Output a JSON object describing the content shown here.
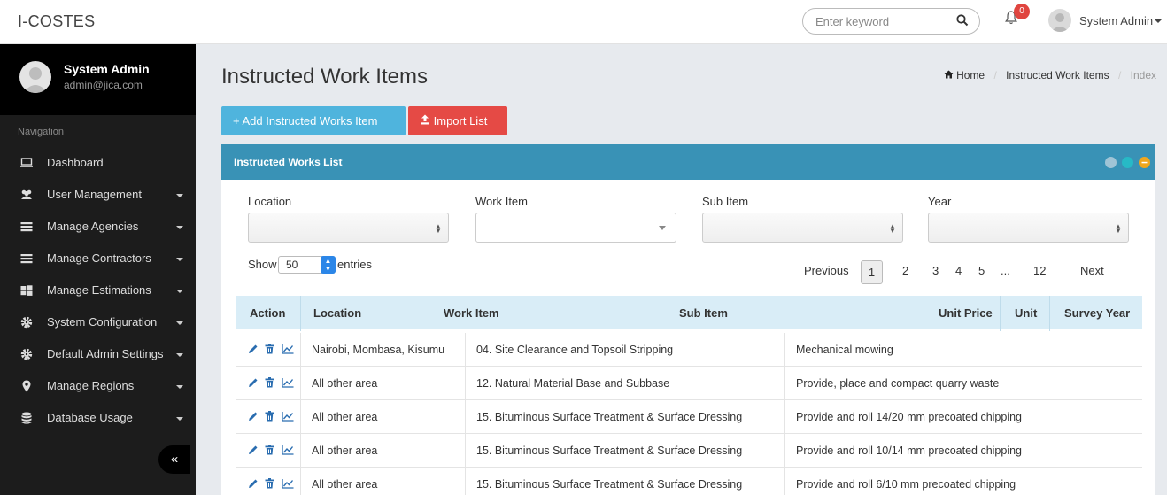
{
  "app": {
    "brand": "I-COSTES"
  },
  "header": {
    "search_placeholder": "Enter keyword",
    "notification_count": "0",
    "user_name": "System Admin"
  },
  "sidebar": {
    "user_name": "System Admin",
    "user_email": "admin@jica.com",
    "nav_label": "Navigation",
    "items": [
      {
        "label": "Dashboard",
        "icon": "laptop-icon",
        "has_caret": false
      },
      {
        "label": "User Management",
        "icon": "users-icon",
        "has_caret": true
      },
      {
        "label": "Manage Agencies",
        "icon": "list-icon",
        "has_caret": true
      },
      {
        "label": "Manage Contractors",
        "icon": "list-icon",
        "has_caret": true
      },
      {
        "label": "Manage Estimations",
        "icon": "windows-icon",
        "has_caret": true
      },
      {
        "label": "System Configuration",
        "icon": "gear-icon",
        "has_caret": true
      },
      {
        "label": "Default Admin Settings",
        "icon": "gear-icon",
        "has_caret": true
      },
      {
        "label": "Manage Regions",
        "icon": "map-marker-icon",
        "has_caret": true
      },
      {
        "label": "Database Usage",
        "icon": "database-icon",
        "has_caret": true
      }
    ],
    "collapse_label": "«"
  },
  "page": {
    "title": "Instructed Work Items",
    "breadcrumb": [
      "Home",
      "Instructed Work Items",
      "Index"
    ],
    "add_button": "+ Add Instructed Works Item",
    "import_button": "Import List"
  },
  "panel": {
    "title": "Instructed Works List",
    "colors": {
      "header": "#3992b6",
      "ctrl_expand": "#9fc4d6",
      "ctrl_refresh": "#27b9c6",
      "ctrl_collapse": "#f0a71d"
    }
  },
  "filters": {
    "location_label": "Location",
    "work_item_label": "Work Item",
    "sub_item_label": "Sub Item",
    "year_label": "Year"
  },
  "table_controls": {
    "show_label": "Show",
    "page_size": "50",
    "entries_label": "entries",
    "pagination": {
      "previous": "Previous",
      "pages": [
        "1",
        "2",
        "3",
        "4",
        "5",
        "...",
        "12"
      ],
      "current": "1",
      "next": "Next"
    }
  },
  "table": {
    "headers": [
      "Action",
      "Location",
      "Work Item",
      "Sub Item",
      "Unit Price",
      "Unit",
      "Survey Year"
    ],
    "rows": [
      {
        "location": "Nairobi, Mombasa, Kisumu",
        "work_item": "04. Site Clearance and Topsoil Stripping",
        "sub_item": "Mechanical mowing",
        "unit_price": "",
        "unit": "",
        "survey_year": ""
      },
      {
        "location": "All other area",
        "work_item": "12. Natural Material Base and Subbase",
        "sub_item": "Provide, place and compact quarry waste",
        "unit_price": "",
        "unit": "",
        "survey_year": ""
      },
      {
        "location": "All other area",
        "work_item": "15. Bituminous Surface Treatment & Surface Dressing",
        "sub_item": "Provide and roll 14/20 mm precoated chipping",
        "unit_price": "",
        "unit": "",
        "survey_year": ""
      },
      {
        "location": "All other area",
        "work_item": "15. Bituminous Surface Treatment & Surface Dressing",
        "sub_item": "Provide and roll 10/14 mm precoated chipping",
        "unit_price": "",
        "unit": "",
        "survey_year": ""
      },
      {
        "location": "All other area",
        "work_item": "15. Bituminous Surface Treatment & Surface Dressing",
        "sub_item": "Provide and roll 6/10 mm precoated chipping",
        "unit_price": "",
        "unit": "",
        "survey_year": ""
      }
    ]
  }
}
